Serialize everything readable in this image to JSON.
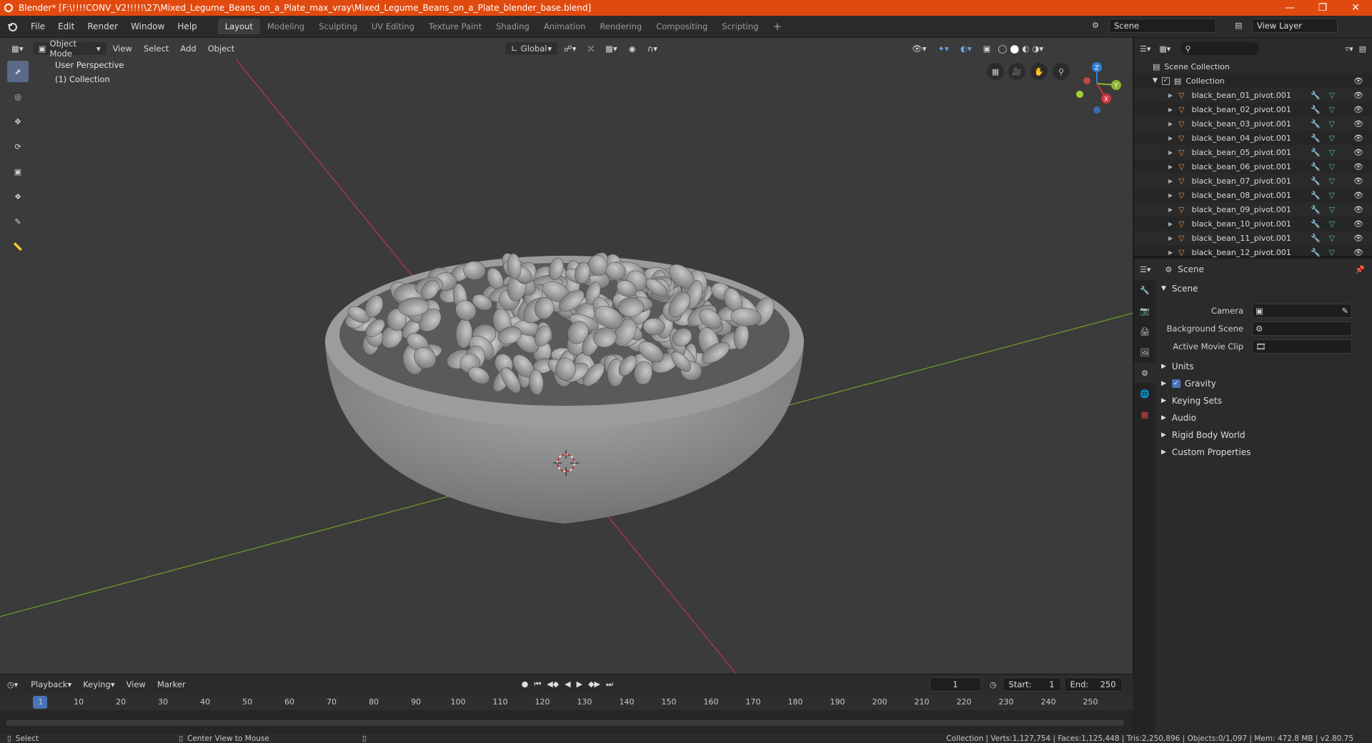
{
  "title": "Blender* [F:\\!!!!CONV_V2!!!!!\\27\\Mixed_Legume_Beans_on_a_Plate_max_vray\\Mixed_Legume_Beans_on_a_Plate_blender_base.blend]",
  "menu": [
    "File",
    "Edit",
    "Render",
    "Window",
    "Help"
  ],
  "workspaces": [
    "Layout",
    "Modeling",
    "Sculpting",
    "UV Editing",
    "Texture Paint",
    "Shading",
    "Animation",
    "Rendering",
    "Compositing",
    "Scripting"
  ],
  "active_workspace": "Layout",
  "scene_name": "Scene",
  "view_layer": "View Layer",
  "viewport": {
    "mode": "Object Mode",
    "menus": [
      "View",
      "Select",
      "Add",
      "Object"
    ],
    "transform_orientation": "Global",
    "perspective_label": "User Perspective",
    "collection_label": "(1) Collection",
    "gizmo": {
      "z": "Z",
      "y": "Y",
      "x": "X"
    }
  },
  "outliner": {
    "root": "Scene Collection",
    "collection": "Collection",
    "items": [
      "black_bean_01_pivot.001",
      "black_bean_02_pivot.001",
      "black_bean_03_pivot.001",
      "black_bean_04_pivot.001",
      "black_bean_05_pivot.001",
      "black_bean_06_pivot.001",
      "black_bean_07_pivot.001",
      "black_bean_08_pivot.001",
      "black_bean_09_pivot.001",
      "black_bean_10_pivot.001",
      "black_bean_11_pivot.001",
      "black_bean_12_pivot.001"
    ]
  },
  "properties": {
    "header": "Scene",
    "section": "Scene",
    "fields": [
      {
        "label": "Camera"
      },
      {
        "label": "Background Scene"
      },
      {
        "label": "Active Movie Clip"
      }
    ],
    "subsections": [
      "Units",
      "Gravity",
      "Keying Sets",
      "Audio",
      "Rigid Body World",
      "Custom Properties"
    ],
    "gravity_checked": true
  },
  "timeline": {
    "menus": [
      "Playback",
      "Keying",
      "View",
      "Marker"
    ],
    "current_frame": "1",
    "start_label": "Start:",
    "start": "1",
    "end_label": "End:",
    "end": "250",
    "ticks": [
      "1",
      "10",
      "20",
      "30",
      "40",
      "50",
      "60",
      "70",
      "80",
      "90",
      "100",
      "110",
      "120",
      "130",
      "140",
      "150",
      "160",
      "170",
      "180",
      "190",
      "200",
      "210",
      "220",
      "230",
      "240",
      "250"
    ]
  },
  "status": {
    "select": "Select",
    "center_view": "Center View to Mouse",
    "stats": "Collection | Verts:1,127,754 | Faces:1,125,448 | Tris:2,250,896 | Objects:0/1,097 | Mem: 472.8 MB | v2.80.75"
  },
  "colors": {
    "accent": "#e04a0f",
    "selected": "#5a6b8a",
    "object_icon": "#e8904a",
    "mesh_icon": "#4ec0a0",
    "x_axis": "#d0353f",
    "y_axis": "#8ab830",
    "z_axis": "#2e7fd8"
  }
}
